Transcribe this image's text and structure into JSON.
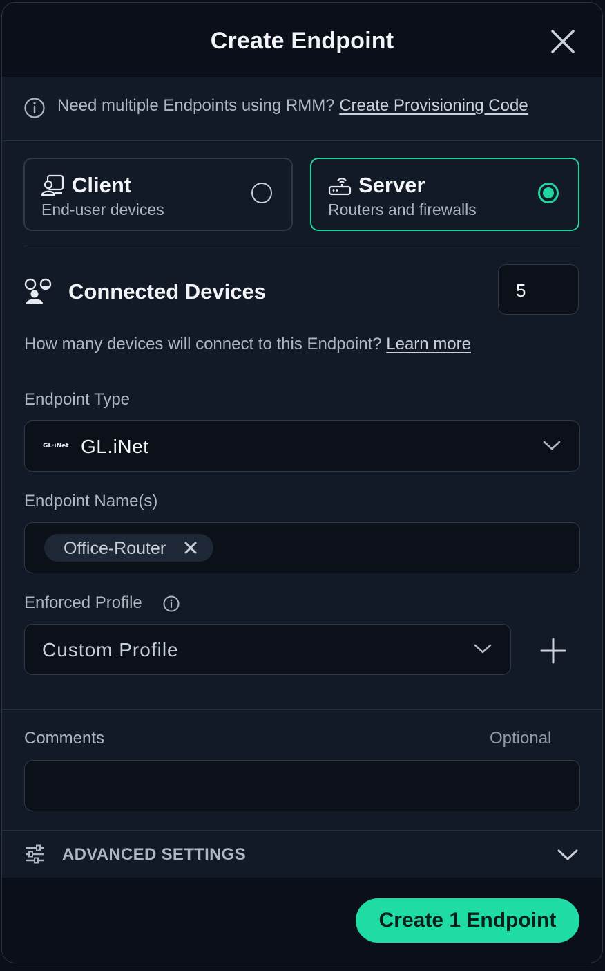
{
  "modal": {
    "title": "Create Endpoint"
  },
  "info": {
    "text": "Need multiple Endpoints using RMM?",
    "link": "Create Provisioning Code"
  },
  "endpoint_kinds": [
    {
      "title": "Client",
      "subtitle": "End-user devices",
      "selected": false
    },
    {
      "title": "Server",
      "subtitle": "Routers and firewalls",
      "selected": true
    }
  ],
  "connected_devices": {
    "title": "Connected Devices",
    "value": "5",
    "help_text": "How many devices will connect to this Endpoint?",
    "help_link": "Learn more"
  },
  "endpoint_type": {
    "label": "Endpoint Type",
    "logo_text": "GL·iNet",
    "value": "GL.iNet"
  },
  "endpoint_names": {
    "label": "Endpoint Name(s)",
    "tags": [
      "Office-Router"
    ]
  },
  "enforced_profile": {
    "label": "Enforced Profile",
    "value": "Custom Profile"
  },
  "comments": {
    "label": "Comments",
    "optional_label": "Optional",
    "value": ""
  },
  "advanced": {
    "label": "ADVANCED SETTINGS"
  },
  "footer": {
    "create_label": "Create 1 Endpoint"
  },
  "colors": {
    "accent": "#1fdca5",
    "background": "#121a27",
    "header": "#0a0f1a"
  }
}
